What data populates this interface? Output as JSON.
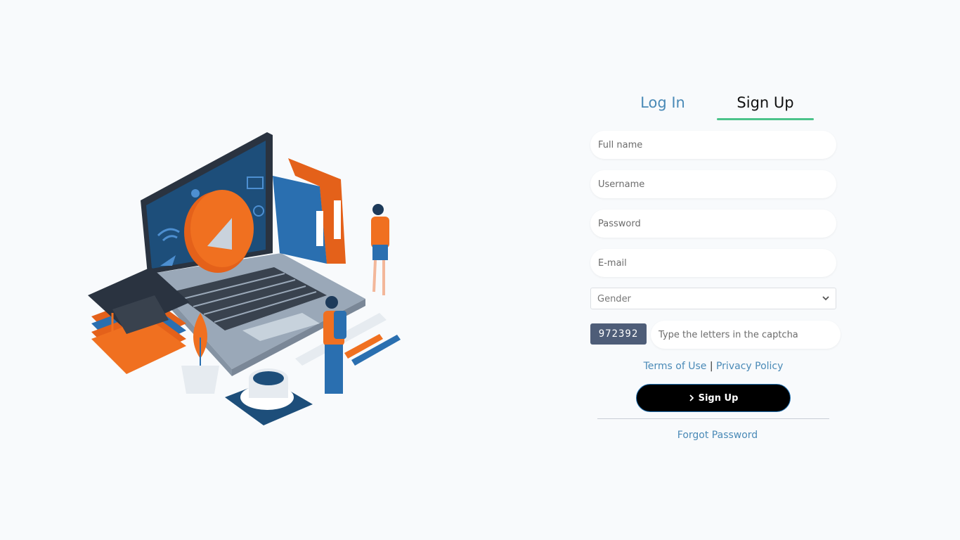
{
  "tabs": {
    "login": "Log In",
    "signup": "Sign Up",
    "active": "signup"
  },
  "form": {
    "full_name_placeholder": "Full name",
    "username_placeholder": "Username",
    "password_placeholder": "Password",
    "email_placeholder": "E-mail",
    "gender_placeholder": "Gender",
    "captcha_code": "972392",
    "captcha_placeholder": "Type the letters in the captcha"
  },
  "legal": {
    "terms": "Terms of Use",
    "separator": "|",
    "privacy": "Privacy Policy"
  },
  "submit": {
    "icon": "chevron-right-icon",
    "label": "Sign Up"
  },
  "forgot_password": "Forgot Password",
  "colors": {
    "accent": "#4cc38a",
    "link": "#4a8ab7",
    "button": "#000000",
    "captcha_bg": "#4e5d78",
    "background": "#f8fafc"
  }
}
